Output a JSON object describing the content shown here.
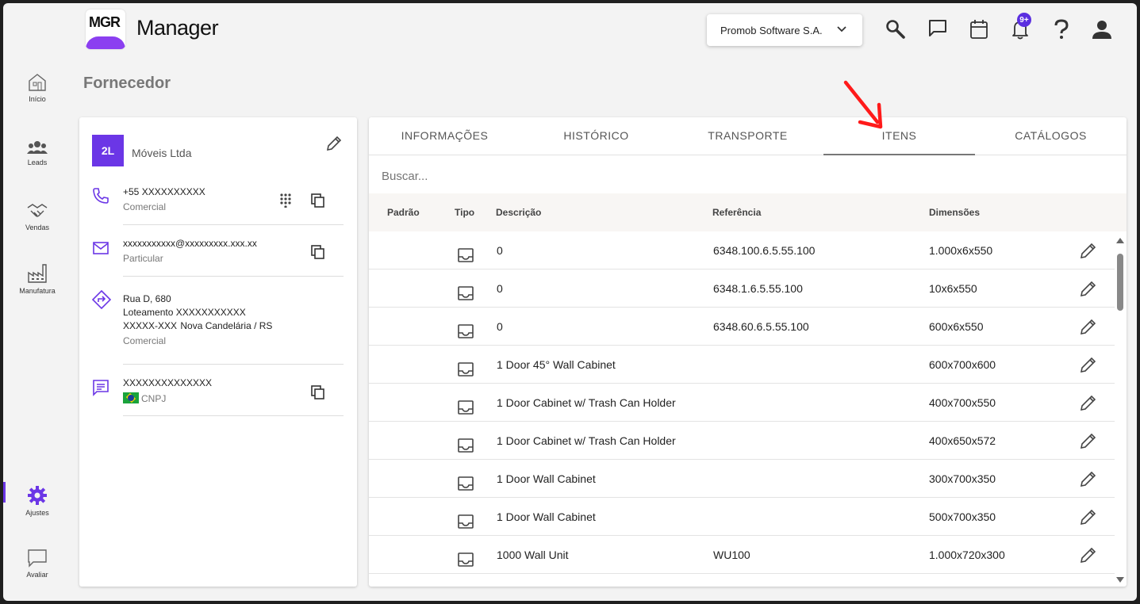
{
  "app": {
    "logo_text": "MGR",
    "title": "Manager"
  },
  "header": {
    "company": "Promob Software S.A.",
    "notifications_badge": "9+"
  },
  "sidebar": {
    "items": [
      {
        "label": "Início",
        "icon": "home-icon"
      },
      {
        "label": "Leads",
        "icon": "people-icon"
      },
      {
        "label": "Vendas",
        "icon": "handshake-icon"
      },
      {
        "label": "Manufatura",
        "icon": "factory-icon"
      },
      {
        "label": "Ajustes",
        "icon": "gear-icon",
        "active": true
      },
      {
        "label": "Avaliar",
        "icon": "chat-icon"
      }
    ]
  },
  "page": {
    "title": "Fornecedor"
  },
  "supplier": {
    "avatar": "2L",
    "name": "Móveis Ltda",
    "phone": {
      "value": "+55 XXXXXXXXXX",
      "type": "Comercial"
    },
    "email": {
      "value": "xxxxxxxxxxx@xxxxxxxxx.xxx.xx",
      "type": "Particular"
    },
    "address": {
      "line1": "Rua D, 680",
      "line2": "Loteamento  XXXXXXXXXXX",
      "line3": "XXXXX-XXX  Nova Candelária / RS",
      "type": "Comercial"
    },
    "document": {
      "value": "XXXXXXXXXXXXXX",
      "type": "CNPJ"
    }
  },
  "tabs": [
    "INFORMAÇÕES",
    "HISTÓRICO",
    "TRANSPORTE",
    "ITENS",
    "CATÁLOGOS"
  ],
  "active_tab": "ITENS",
  "search": {
    "placeholder": "Buscar..."
  },
  "table": {
    "columns": [
      "Padrão",
      "Tipo",
      "Descrição",
      "Referência",
      "Dimensões"
    ],
    "rows": [
      {
        "descricao": "0",
        "referencia": "6348.100.6.5.55.100",
        "dimensoes": "1.000x6x550"
      },
      {
        "descricao": "0",
        "referencia": "6348.1.6.5.55.100",
        "dimensoes": "10x6x550"
      },
      {
        "descricao": "0",
        "referencia": "6348.60.6.5.55.100",
        "dimensoes": "600x6x550"
      },
      {
        "descricao": "1 Door 45° Wall Cabinet",
        "referencia": "",
        "dimensoes": "600x700x600"
      },
      {
        "descricao": "1 Door Cabinet w/ Trash Can Holder",
        "referencia": "",
        "dimensoes": "400x700x550"
      },
      {
        "descricao": "1 Door Cabinet w/ Trash Can Holder",
        "referencia": "",
        "dimensoes": "400x650x572"
      },
      {
        "descricao": "1 Door Wall Cabinet",
        "referencia": "",
        "dimensoes": "300x700x350"
      },
      {
        "descricao": "1 Door Wall Cabinet",
        "referencia": "",
        "dimensoes": "500x700x350"
      },
      {
        "descricao": "1000 Wall Unit",
        "referencia": "WU100",
        "dimensoes": "1.000x720x300"
      }
    ]
  },
  "colors": {
    "accent": "#6b36e6",
    "annotation_arrow": "#ff1a1a"
  }
}
